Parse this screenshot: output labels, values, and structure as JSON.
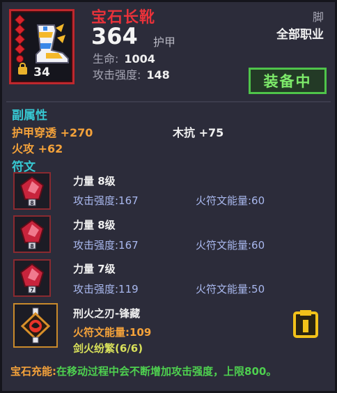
{
  "item": {
    "name": "宝石长靴",
    "level": "34",
    "armor_value": "364",
    "armor_label": "护甲",
    "slot": "脚",
    "job": "全部职业",
    "stats": [
      {
        "label": "生命:",
        "value": "1004"
      },
      {
        "label": "攻击强度:",
        "value": "148"
      }
    ]
  },
  "equip_button": "装备中",
  "sections": {
    "sub_attributes": "副属性",
    "runes": "符文"
  },
  "sub_attributes": [
    {
      "label": "护甲穿透 +270",
      "color": "#f4a23a"
    },
    {
      "label": "木抗 +75",
      "color": "#f0f0f0"
    },
    {
      "label": "火攻 +62",
      "color": "#f4a23a"
    }
  ],
  "runes": [
    {
      "name": "力量 8级",
      "attack": "攻击强度:167",
      "energy": "火符文能量:60",
      "badge": "8"
    },
    {
      "name": "力量 8级",
      "attack": "攻击强度:167",
      "energy": "火符文能量:60",
      "badge": "8"
    },
    {
      "name": "力量 7级",
      "attack": "攻击强度:119",
      "energy": "火符文能量:50",
      "badge": "7"
    }
  ],
  "legendary_rune": {
    "name": "刑火之刃-锋藏",
    "energy": "火符文能量:109",
    "set": "剑火纷繁(6/6)"
  },
  "footer": {
    "key": "宝石充能:",
    "value": "在移动过程中会不断增加攻击强度，上限800。"
  },
  "colors": {
    "title_red": "#e8323a",
    "section_cyan": "#37c8d2",
    "equip_green": "#4fc44a",
    "orange": "#f4a23a",
    "rune_blue": "#a9b8ee"
  },
  "icons": [
    "boot-icon",
    "lock-icon",
    "ruby-rune-icon",
    "fire-blade-rune-icon",
    "clipboard-icon"
  ]
}
